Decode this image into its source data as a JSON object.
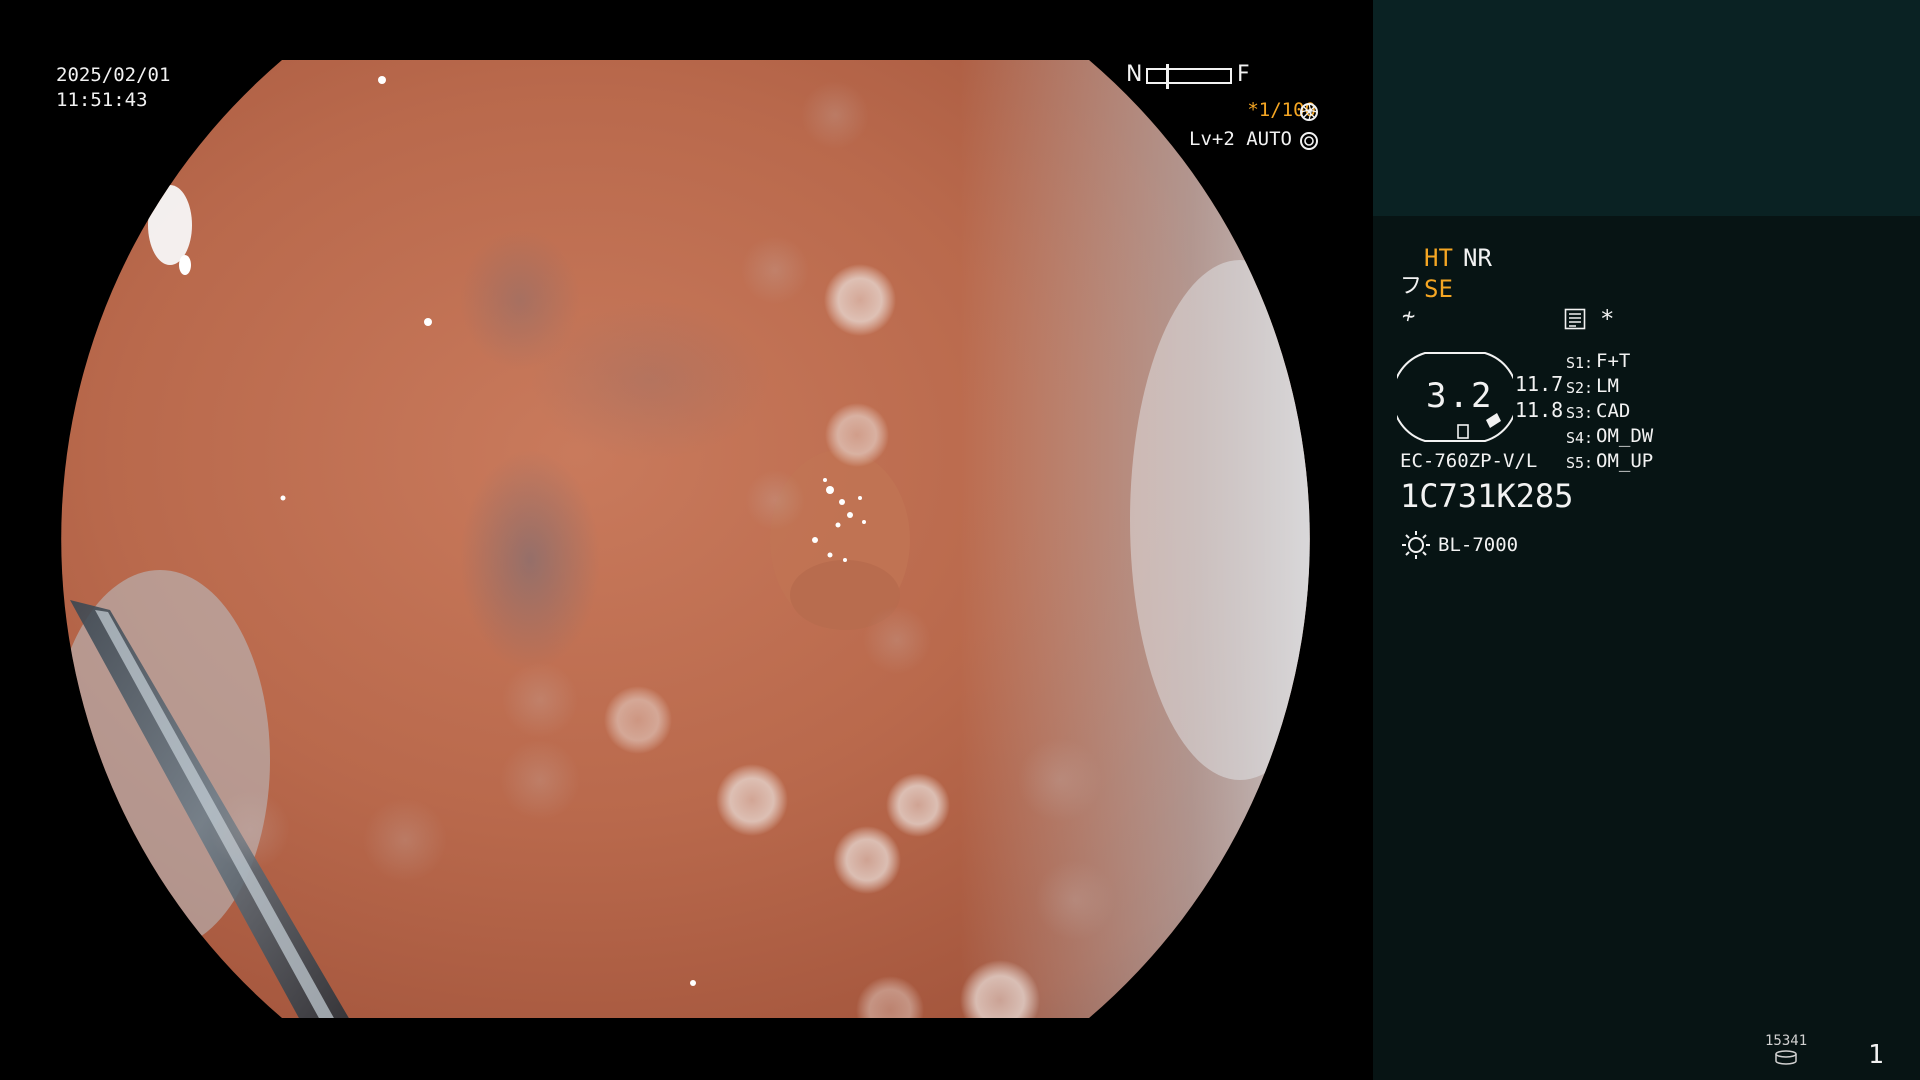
{
  "overlay": {
    "date": "2025/02/01",
    "time": "11:51:43",
    "focus_near": "N",
    "focus_far": "F",
    "shutter": "*1/100",
    "shutter_icon": "aperture-icon",
    "level": "Lv+2 AUTO",
    "level_icon": "iris-icon"
  },
  "panel": {
    "ht": "HT",
    "nr": "NR",
    "se_icon": "フ",
    "se": "SE",
    "nf_icon": "≁",
    "memo_icon": "memo-icon",
    "asterisk": "*",
    "zoom_value": "3.2",
    "value_a": "11.7",
    "value_b": "11.8",
    "switches": [
      {
        "key": "S1:",
        "value": "F+T"
      },
      {
        "key": "S2:",
        "value": "LM"
      },
      {
        "key": "S3:",
        "value": "CAD"
      },
      {
        "key": "S4:",
        "value": "OM_DW"
      },
      {
        "key": "S5:",
        "value": "OM_UP"
      }
    ],
    "scope_model": "EC-760ZP-V/L",
    "scope_serial": "1C731K285",
    "light_source": "BL-7000",
    "light_icon": "lamp-icon",
    "image_count": "15341",
    "disk_icon": "storage-icon",
    "page_number": "1"
  },
  "colors": {
    "accent_orange": "#f5a623",
    "panel_top": "#0a2223",
    "panel_bottom": "#071414",
    "text": "#f2f2f2"
  }
}
